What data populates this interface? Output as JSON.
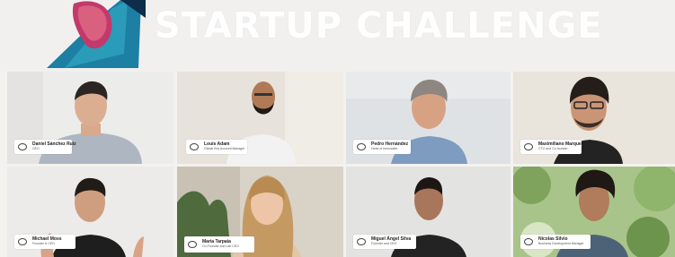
{
  "banner": {
    "title": "STARTUP CHALLENGE"
  },
  "participants": [
    {
      "name": "Daniel Sánchez Ruiz",
      "role": "CEO"
    },
    {
      "name": "Louis Adam",
      "role": "Global Key Account Manager"
    },
    {
      "name": "Pedro Hernández",
      "role": "Head of Innovation"
    },
    {
      "name": "Maximiliano Marquez",
      "role": "CTO and Co-founder"
    },
    {
      "name": "Michael Moss",
      "role": "Founder & CEO"
    },
    {
      "name": "Maria Tarpaia",
      "role": "Co-Founder and Lab CEO"
    },
    {
      "name": "Miguel Ángel Silva",
      "role": "Founder and CEO"
    },
    {
      "name": "Nicolas Silvio",
      "role": "Business Development Manager"
    }
  ]
}
